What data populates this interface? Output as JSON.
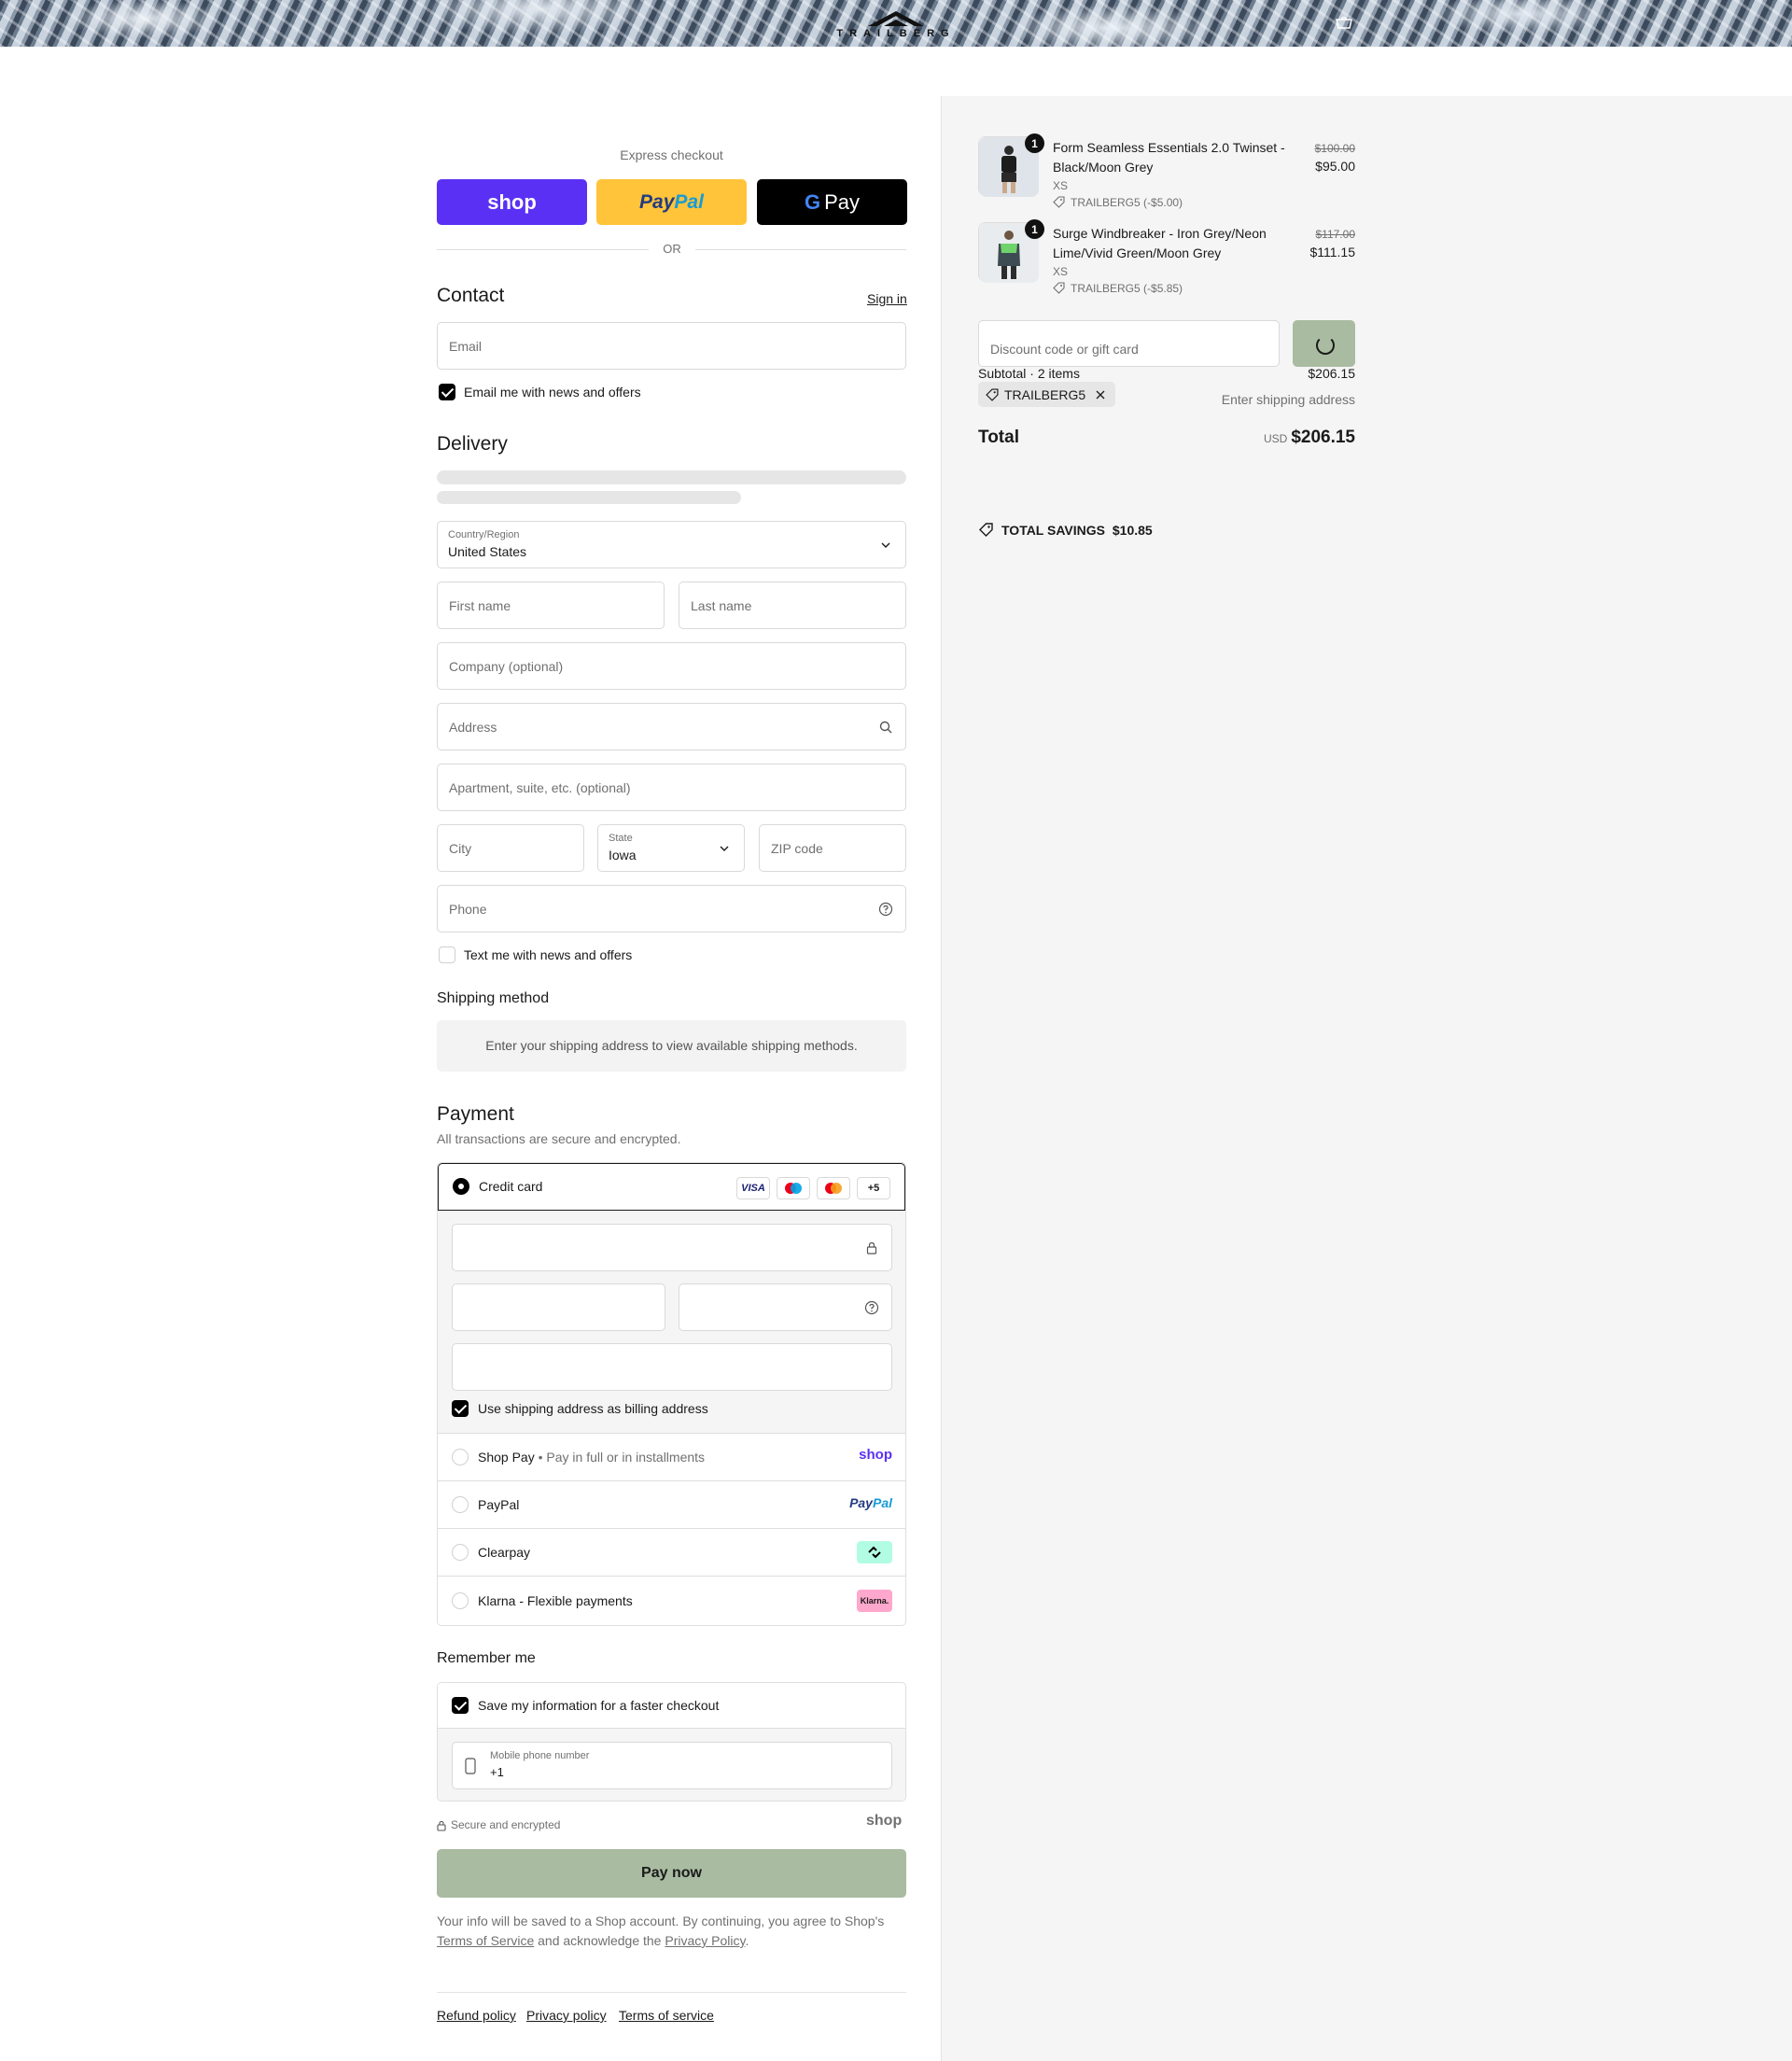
{
  "header": {
    "logo_text": "TRAILBERG"
  },
  "express": {
    "label": "Express checkout",
    "shop_label": "shop",
    "paypal_pay": "Pay",
    "paypal_pal": "Pal",
    "gpay_g": "G",
    "gpay_label": "Pay",
    "or_label": "OR"
  },
  "contact": {
    "title": "Contact",
    "sign_in": "Sign in",
    "email_placeholder": "Email",
    "news_label": "Email me with news and offers"
  },
  "delivery": {
    "title": "Delivery",
    "country_label": "Country/Region",
    "country_value": "United States",
    "first_name": "First name",
    "last_name": "Last name",
    "company": "Company (optional)",
    "address": "Address",
    "apartment": "Apartment, suite, etc. (optional)",
    "city": "City",
    "state_label": "State",
    "state_value": "Iowa",
    "zip": "ZIP code",
    "phone": "Phone",
    "text_label": "Text me with news and offers"
  },
  "shipping": {
    "title": "Shipping method",
    "message": "Enter your shipping address to view available shipping methods."
  },
  "payment": {
    "title": "Payment",
    "subtitle": "All transactions are secure and encrypted.",
    "credit_card": "Credit card",
    "card_badges": [
      "VISA",
      "",
      "",
      "+5"
    ],
    "billing_label": "Use shipping address as billing address",
    "shop_pay": "Shop Pay",
    "shop_pay_sub": "Pay in full or in installments",
    "shop_pay_logo": "shop",
    "paypal": "PayPal",
    "paypal_logo_pay": "Pay",
    "paypal_logo_pal": "Pal",
    "clearpay": "Clearpay",
    "klarna": "Klarna - Flexible payments",
    "klarna_logo": "Klarna."
  },
  "remember": {
    "title": "Remember me",
    "save_label": "Save my information for a faster checkout",
    "mobile_label": "Mobile phone number",
    "mobile_value": "+1",
    "secure_label": "Secure and encrypted",
    "shop_logo": "shop"
  },
  "pay_now": "Pay now",
  "legal": {
    "text1": "Your info will be saved to a Shop account. By continuing, you agree to Shop's",
    "terms": "Terms of Service",
    "text2": "and acknowledge the",
    "privacy": "Privacy Policy",
    "text3": "."
  },
  "footer": {
    "refund": "Refund policy",
    "privacy": "Privacy policy",
    "terms": "Terms of service"
  },
  "summary": {
    "items": [
      {
        "qty": "1",
        "name": "Form Seamless Essentials 2.0 Twinset - Black/Moon Grey",
        "variant": "XS",
        "discount": "TRAILBERG5 (-$5.00)",
        "old_price": "$100.00",
        "price": "$95.00"
      },
      {
        "qty": "1",
        "name": "Surge Windbreaker - Iron Grey/Neon Lime/Vivid Green/Moon Grey",
        "variant": "XS",
        "discount": "TRAILBERG5 (-$5.85)",
        "old_price": "$117.00",
        "price": "$111.15"
      }
    ],
    "discount_placeholder": "Discount code or gift card",
    "subtotal_label": "Subtotal · 2 items",
    "subtotal_value": "$206.15",
    "code_tag": "TRAILBERG5",
    "shipping_note": "Enter shipping address",
    "total_label": "Total",
    "currency": "USD",
    "total_value": "$206.15",
    "savings_label": "TOTAL SAVINGS",
    "savings_value": "$10.85"
  }
}
